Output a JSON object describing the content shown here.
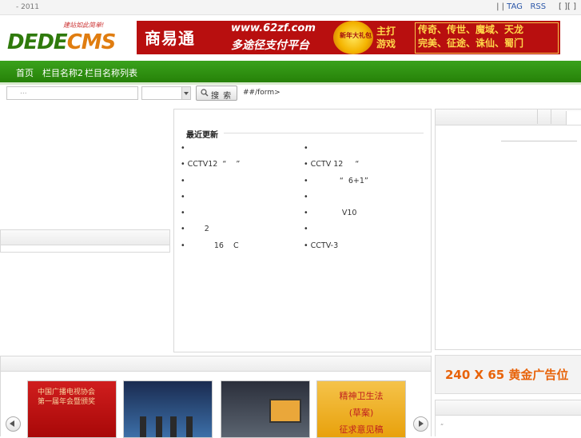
{
  "topbar": {
    "date": "- 2011",
    "links_prefix": "|   |",
    "tag_link": "TAG",
    "rss_link": "RSS",
    "links_suffix": "[   ][   ]"
  },
  "header": {
    "logo_main_a": "DEDE",
    "logo_main_b": "CMS",
    "logo_slogan": "建站如此简单!",
    "banner_brand": "商易通",
    "banner_url": "www.62zf.com",
    "banner_tagline": "多途径支付平台",
    "banner_coin": "新年大礼包",
    "banner_games_label": "主打\n游戏",
    "banner_games_row1": "传奇、传世、魔域、天龙",
    "banner_games_row2": "完美、征途、诛仙、蜀门"
  },
  "nav": {
    "items": [
      "首页",
      "栏目名称2",
      "栏目名称列表"
    ]
  },
  "search": {
    "input_placeholder": "...",
    "select_value": "",
    "button_label": "搜 索",
    "note": "##/form>"
  },
  "latest": {
    "title": "最近更新",
    "left_items": [
      "•",
      "• CCTV12  “    ”",
      "•",
      "•",
      "•",
      "•        2",
      "•            16    C"
    ],
    "right_items": [
      "•",
      "• CCTV 12     “",
      "•             “  6+1”",
      "•",
      "•              V10",
      "•",
      "• CCTV-3"
    ]
  },
  "gallery": {
    "thumb1_text": "中国广播电视协会\n第一届年会暨颁奖",
    "thumb4_lines": [
      "精神卫生法",
      "(草案)",
      "征求意见稿"
    ]
  },
  "ad": {
    "text": "240 X 65 黄金广告位"
  },
  "bottom_right": {
    "item": "“"
  },
  "colors": {
    "nav_green": "#2b8d0d",
    "banner_red": "#b80f0f",
    "ad_orange": "#e8630a",
    "link_blue": "#2a56a8"
  }
}
